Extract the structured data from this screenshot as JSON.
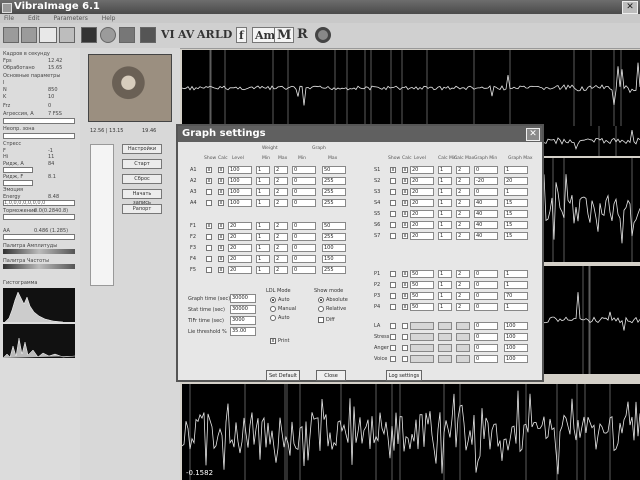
{
  "window": {
    "title": "VibraImage 6.1",
    "close_glyph": "✕"
  },
  "menu": [
    "File",
    "Edit",
    "Parameters",
    "Help"
  ],
  "toolbar": {
    "text_buttons": [
      "VI",
      "AV",
      "AR",
      "LD",
      "f",
      "Am",
      "M",
      "R"
    ],
    "icons": [
      "save-icon",
      "open-icon",
      "settings-icon",
      "film-icon",
      "camera-icon",
      "disc-icon",
      "monitor-icon",
      "portrait-icon",
      "record-icon"
    ]
  },
  "left_panel": {
    "rows": [
      {
        "label": "Кадров в секунду",
        "value": ""
      },
      {
        "label": "Fps",
        "value": "12.42"
      },
      {
        "label": "Обработано",
        "value": "15.65"
      },
      {
        "label": "Основные параметры",
        "value": ""
      },
      {
        "label": "I",
        "value": ""
      },
      {
        "label": "N",
        "value": "850"
      },
      {
        "label": "K",
        "value": "10"
      },
      {
        "label": "Frz",
        "value": "0"
      },
      {
        "label": "Агрессия, A",
        "value": "7 FSS"
      }
    ],
    "fields": [
      "",
      "Неопр. зона",
      "",
      "Стресс"
    ],
    "rows2": [
      {
        "label": "F",
        "value": "-1"
      },
      {
        "label": "Hi",
        "value": "11"
      },
      {
        "label": "Ридж, A",
        "value": "84"
      },
      {
        "label": "Ридж, F",
        "value": "8.1"
      },
      {
        "label": "Эмоция",
        "value": ""
      }
    ],
    "energy_label": "Energy",
    "energy_value": "8.48",
    "energy_field": "1,0,0,0,0,0,0,0,0",
    "inhib_label": "Торможение",
    "inhib_value": "0.0(0.2840.8)",
    "aa_label": "AA",
    "aa_value": "0.486 (1.285)",
    "palette1": "Палитра Амплитуды",
    "palette2": "Палитра Частоты",
    "hist_label": "Гистограмма"
  },
  "video_panel": {
    "size_label": "12.56 | 13.15",
    "fps_label": "19.46",
    "buttons": [
      "Настройки",
      "Старт",
      "Сброс",
      "Начать запись",
      "Рапорт"
    ]
  },
  "big_graph": {
    "value_label": "-0.1582"
  },
  "dialog": {
    "title": "Graph settings",
    "close_glyph": "✕",
    "col_headers_left": [
      "Show",
      "Calc",
      "Level",
      "Min",
      "Max",
      "Min",
      "Max"
    ],
    "col_headers_left_top": [
      "Weight",
      "Graph"
    ],
    "col_headers_right": [
      "Show",
      "Calc",
      "Level",
      "Calc Min",
      "Calc Max",
      "Graph Min",
      "Graph Max"
    ],
    "groupA": [
      {
        "label": "A1",
        "show": "x",
        "calc": "x",
        "level": "100",
        "w1": "1",
        "w2": "2",
        "g1": "0",
        "g2": "50"
      },
      {
        "label": "A2",
        "show": "x",
        "calc": "x",
        "level": "100",
        "w1": "1",
        "w2": "2",
        "g1": "0",
        "g2": "255"
      },
      {
        "label": "A3",
        "show": "",
        "calc": "x",
        "level": "100",
        "w1": "1",
        "w2": "2",
        "g1": "0",
        "g2": "255"
      },
      {
        "label": "A4",
        "show": "",
        "calc": "x",
        "level": "100",
        "w1": "1",
        "w2": "2",
        "g1": "0",
        "g2": "255"
      }
    ],
    "groupF": [
      {
        "label": "F1",
        "show": "x",
        "calc": "x",
        "level": "20",
        "w1": "1",
        "w2": "2",
        "g1": "0",
        "g2": "50"
      },
      {
        "label": "F2",
        "show": "",
        "calc": "x",
        "level": "20",
        "w1": "1",
        "w2": "2",
        "g1": "0",
        "g2": "255"
      },
      {
        "label": "F3",
        "show": "",
        "calc": "x",
        "level": "20",
        "w1": "1",
        "w2": "2",
        "g1": "0",
        "g2": "100"
      },
      {
        "label": "F4",
        "show": "",
        "calc": "x",
        "level": "20",
        "w1": "1",
        "w2": "2",
        "g1": "0",
        "g2": "150"
      },
      {
        "label": "F5",
        "show": "",
        "calc": "x",
        "level": "20",
        "w1": "1",
        "w2": "2",
        "g1": "0",
        "g2": "255"
      }
    ],
    "groupS": [
      {
        "label": "S1",
        "show": "x",
        "calc": "x",
        "level": "20",
        "c1": "1",
        "c2": "2",
        "g1": "0",
        "g2": "1"
      },
      {
        "label": "S2",
        "show": "",
        "calc": "x",
        "level": "20",
        "c1": "1",
        "c2": "2",
        "g1": "-20",
        "g2": "20"
      },
      {
        "label": "S3",
        "show": "",
        "calc": "x",
        "level": "20",
        "c1": "1",
        "c2": "2",
        "g1": "0",
        "g2": "1"
      },
      {
        "label": "S4",
        "show": "",
        "calc": "x",
        "level": "20",
        "c1": "1",
        "c2": "2",
        "g1": "40",
        "g2": "15"
      },
      {
        "label": "S5",
        "show": "",
        "calc": "x",
        "level": "20",
        "c1": "1",
        "c2": "2",
        "g1": "40",
        "g2": "15"
      },
      {
        "label": "S6",
        "show": "",
        "calc": "x",
        "level": "20",
        "c1": "1",
        "c2": "2",
        "g1": "40",
        "g2": "15"
      },
      {
        "label": "S7",
        "show": "",
        "calc": "x",
        "level": "20",
        "c1": "1",
        "c2": "2",
        "g1": "40",
        "g2": "15"
      }
    ],
    "groupP": [
      {
        "label": "P1",
        "show": "",
        "calc": "x",
        "level": "50",
        "c1": "1",
        "c2": "2",
        "g1": "0",
        "g2": "1"
      },
      {
        "label": "P2",
        "show": "",
        "calc": "x",
        "level": "50",
        "c1": "1",
        "c2": "2",
        "g1": "0",
        "g2": "1"
      },
      {
        "label": "P3",
        "show": "",
        "calc": "x",
        "level": "50",
        "c1": "1",
        "c2": "2",
        "g1": "0",
        "g2": "70"
      },
      {
        "label": "P4",
        "show": "",
        "calc": "x",
        "level": "50",
        "c1": "1",
        "c2": "2",
        "g1": "0",
        "g2": "1"
      }
    ],
    "groupL": [
      {
        "label": "LA",
        "show": "",
        "calc": "",
        "level": "",
        "c1": "",
        "c2": "",
        "g1": "0",
        "g2": "100"
      },
      {
        "label": "Stress",
        "show": "",
        "calc": "",
        "level": "",
        "c1": "",
        "c2": "",
        "g1": "0",
        "g2": "100"
      },
      {
        "label": "Anger",
        "show": "",
        "calc": "",
        "level": "",
        "c1": "",
        "c2": "",
        "g1": "0",
        "g2": "100"
      },
      {
        "label": "Voice",
        "show": "",
        "calc": "",
        "level": "",
        "c1": "",
        "c2": "",
        "g1": "0",
        "g2": "100"
      }
    ],
    "graph_time_label": "Graph time (sec)",
    "graph_time": "30000",
    "stat_time_label": "Stat time (sec)",
    "stat_time": "30000",
    "tifr_label": "TIFr time (sec)",
    "tifr": "3000",
    "lie_label": "Lie threshold %",
    "lie": "35.00",
    "lfl_title": "LDL Mode",
    "lfl_options": [
      "Auto",
      "Manual",
      "Auto"
    ],
    "show_title": "Show mode",
    "show_options": [
      "Absolute",
      "Relative",
      "Diff"
    ],
    "print_label": "Print",
    "btn_default": "Set Default",
    "btn_close": "Close",
    "btn_log": "Log settings"
  }
}
